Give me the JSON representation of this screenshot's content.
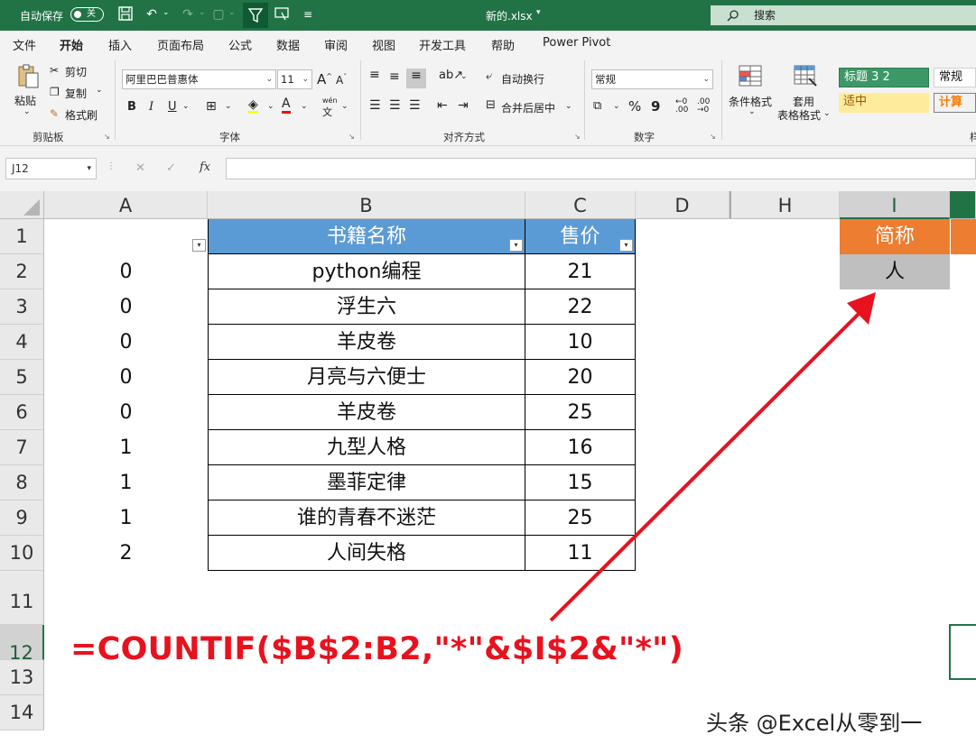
{
  "titlebar": {
    "autosave_label": "自动保存",
    "autosave_state": "关",
    "filename": "新的.xlsx",
    "search_placeholder": "搜索",
    "icons": [
      "save-icon",
      "undo-icon",
      "redo-icon",
      "format-icon",
      "filter-icon",
      "screen-icon",
      "customize-icon",
      "search-icon"
    ]
  },
  "tabs": [
    "文件",
    "开始",
    "插入",
    "页面布局",
    "公式",
    "数据",
    "审阅",
    "视图",
    "开发工具",
    "帮助",
    "Power Pivot"
  ],
  "active_tab": "开始",
  "ribbon": {
    "clipboard": {
      "paste": "粘贴",
      "cut": "剪切",
      "copy": "复制",
      "painter": "格式刷",
      "group": "剪贴板"
    },
    "font": {
      "name": "阿里巴巴普惠体",
      "size": "11",
      "bold": "B",
      "italic": "I",
      "underline": "U",
      "grow": "A",
      "shrink": "A",
      "wen": "wén",
      "wen_sub": "文",
      "group": "字体"
    },
    "align": {
      "wrap": "自动换行",
      "merge": "合并后居中",
      "group": "对齐方式"
    },
    "number": {
      "format": "常规",
      "percent": "%",
      "comma": "9",
      "group": "数字"
    },
    "styles": {
      "cond": "条件格式",
      "table_top": "套用",
      "table_bottom": "表格格式",
      "heading": "标题 3 2",
      "normal": "常规",
      "neutral": "适中",
      "calc": "计算",
      "group_partial": "样"
    }
  },
  "formula_bar": {
    "name_box": "J12",
    "cancel": "✕",
    "enter": "✓",
    "fx": "fx",
    "value": ""
  },
  "columns": [
    "A",
    "B",
    "C",
    "D",
    "H",
    "I"
  ],
  "selected_column": "I",
  "rows": [
    "1",
    "2",
    "3",
    "4",
    "5",
    "6",
    "7",
    "8",
    "9",
    "10",
    "11",
    "12",
    "13",
    "14"
  ],
  "table": {
    "headers": {
      "b": "书籍名称",
      "c": "售价"
    },
    "data": [
      {
        "a": "0",
        "b": "python编程",
        "c": "21"
      },
      {
        "a": "0",
        "b": "浮生六",
        "c": "22"
      },
      {
        "a": "0",
        "b": "羊皮卷",
        "c": "10"
      },
      {
        "a": "0",
        "b": "月亮与六便士",
        "c": "20"
      },
      {
        "a": "0",
        "b": "羊皮卷",
        "c": "25"
      },
      {
        "a": "1",
        "b": "九型人格",
        "c": "16"
      },
      {
        "a": "1",
        "b": "墨菲定律",
        "c": "15"
      },
      {
        "a": "1",
        "b": "谁的青春不迷茫",
        "c": "25"
      },
      {
        "a": "2",
        "b": "人间失格",
        "c": "11"
      }
    ]
  },
  "side": {
    "header": "简称",
    "value": "人"
  },
  "annotation": {
    "formula": "=COUNTIF($B$2:B2,\"*\"&$I$2&\"*\")",
    "color": "#e8121e"
  },
  "watermark": "头条 @Excel从零到一",
  "colors": {
    "brand": "#217346",
    "header_blue": "#5b9bd5",
    "header_orange": "#ed7d31",
    "value_gray": "#bfbfbf"
  }
}
